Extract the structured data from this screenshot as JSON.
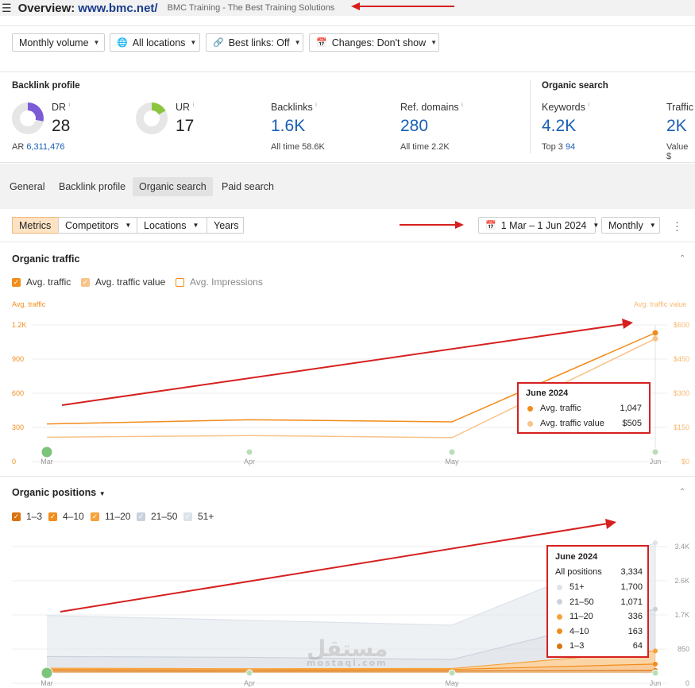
{
  "header": {
    "title": "Overview:",
    "site": "www.bmc.net/",
    "subtitle": "BMC Training - The Best Training Solutions"
  },
  "filters": {
    "volume": "Monthly volume",
    "locations": "All locations",
    "best_links": "Best links: Off",
    "changes": "Changes: Don't show"
  },
  "backlink_profile": {
    "label": "Backlink profile",
    "dr": {
      "label": "DR",
      "value": "28",
      "ar_label": "AR",
      "ar_value": "6,311,476",
      "fraction": 0.28,
      "color": "#7b5cd6"
    },
    "ur": {
      "label": "UR",
      "value": "17",
      "fraction": 0.17,
      "color": "#8cc63f"
    },
    "backlinks": {
      "label": "Backlinks",
      "value": "1.6K",
      "sub_label": "All time",
      "sub_value": "58.6K"
    },
    "ref_domains": {
      "label": "Ref. domains",
      "value": "280",
      "sub_label": "All time",
      "sub_value": "2.2K"
    }
  },
  "organic_search": {
    "label": "Organic search",
    "keywords": {
      "label": "Keywords",
      "value": "4.2K",
      "sub_label": "Top 3",
      "sub_value": "94"
    },
    "traffic": {
      "label": "Traffic",
      "value": "2K",
      "sub_label": "Value",
      "sub_value": "$"
    }
  },
  "tabs": [
    "General",
    "Backlink profile",
    "Organic search",
    "Paid search"
  ],
  "toolbar": {
    "segments": [
      "Metrics",
      "Competitors",
      "Locations",
      "Years"
    ],
    "date_range": "1 Mar – 1 Jun 2024",
    "granularity": "Monthly"
  },
  "organic_traffic": {
    "title": "Organic traffic",
    "legend": [
      "Avg. traffic",
      "Avg. traffic value",
      "Avg. Impressions"
    ],
    "left_axis_label": "Avg. traffic",
    "right_axis_label": "Avg. traffic value",
    "left_ticks": [
      "1.2K",
      "900",
      "600",
      "300",
      "0"
    ],
    "right_ticks": [
      "$600",
      "$450",
      "$300",
      "$150",
      "$0"
    ],
    "x_ticks": [
      "Mar",
      "Apr",
      "May",
      "Jun"
    ],
    "tooltip": {
      "title": "June 2024",
      "rows": [
        {
          "label": "Avg. traffic",
          "value": "1,047",
          "color": "#f28c1a"
        },
        {
          "label": "Avg. traffic value",
          "value": "$505",
          "color": "#f7c38a"
        }
      ]
    }
  },
  "organic_positions": {
    "title": "Organic positions",
    "legend": [
      "1–3",
      "4–10",
      "11–20",
      "21–50",
      "51+"
    ],
    "right_ticks": [
      "3.4K",
      "2.6K",
      "1.7K",
      "850",
      "0"
    ],
    "x_ticks": [
      "Mar",
      "Apr",
      "May",
      "Jun"
    ],
    "tooltip": {
      "title": "June 2024",
      "total_label": "All positions",
      "total_value": "3,334",
      "rows": [
        {
          "label": "51+",
          "value": "1,700",
          "color": "#dde3ea"
        },
        {
          "label": "21–50",
          "value": "1,071",
          "color": "#c9d2dc"
        },
        {
          "label": "11–20",
          "value": "336",
          "color": "#f7a23a"
        },
        {
          "label": "4–10",
          "value": "163",
          "color": "#f28c1a"
        },
        {
          "label": "1–3",
          "value": "64",
          "color": "#d9730d"
        }
      ]
    }
  },
  "watermark": {
    "text": "مستقل",
    "sub": "mostaql.com"
  },
  "chart_data": [
    {
      "type": "line",
      "title": "Organic traffic",
      "x": [
        "Mar",
        "Apr",
        "May",
        "Jun"
      ],
      "series": [
        {
          "name": "Avg. traffic",
          "axis": "left",
          "values": [
            265,
            305,
            285,
            1125
          ],
          "color": "#f28c1a"
        },
        {
          "name": "Avg. traffic value",
          "axis": "right",
          "values": [
            70,
            78,
            68,
            535
          ],
          "color": "#f7c38a"
        }
      ],
      "ylim_left": [
        0,
        1200
      ],
      "ylim_right": [
        0,
        600
      ]
    },
    {
      "type": "area",
      "title": "Organic positions",
      "x": [
        "Mar",
        "Apr",
        "May",
        "Jun"
      ],
      "series": [
        {
          "name": "1–3",
          "values": [
            50,
            45,
            48,
            64
          ],
          "color": "#d9730d"
        },
        {
          "name": "4–10",
          "values": [
            40,
            35,
            40,
            163
          ],
          "color": "#f28c1a"
        },
        {
          "name": "11–20",
          "values": [
            30,
            28,
            25,
            336
          ],
          "color": "#f7a23a"
        },
        {
          "name": "21–50",
          "values": [
            300,
            290,
            230,
            1071
          ],
          "color": "#c9d2dc"
        },
        {
          "name": "51+",
          "values": [
            1050,
            950,
            880,
            1700
          ],
          "color": "#dde3ea"
        }
      ],
      "ylim": [
        0,
        3400
      ]
    }
  ]
}
